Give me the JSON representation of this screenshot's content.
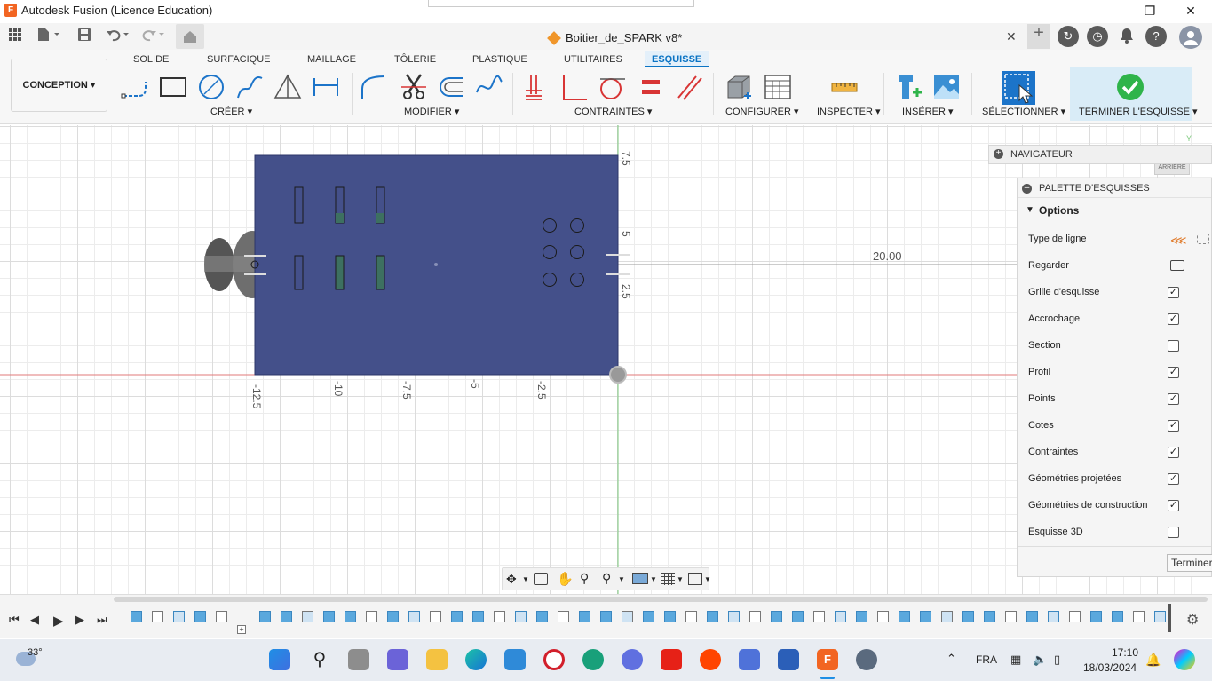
{
  "window": {
    "title": "Autodesk Fusion (Licence Education)"
  },
  "document": {
    "name": "Boitier_de_SPARK v8*"
  },
  "workspace": {
    "label": "CONCEPTION"
  },
  "ribbon": {
    "tabs": [
      "SOLIDE",
      "SURFACIQUE",
      "MAILLAGE",
      "TÔLERIE",
      "PLASTIQUE",
      "UTILITAIRES",
      "ESQUISSE"
    ],
    "active_tab": "ESQUISSE",
    "groups": {
      "create": "CRÉER",
      "modify": "MODIFIER",
      "constraints": "CONTRAINTES",
      "configure": "CONFIGURER",
      "inspect": "INSPECTER",
      "insert": "INSÉRER",
      "select": "SÉLECTIONNER",
      "finish": "TERMINER L'ESQUISSE"
    }
  },
  "canvas": {
    "x_ticks": [
      "-12.5",
      "-10",
      "-7.5",
      "-5",
      "-2.5"
    ],
    "y_ticks": [
      "7.5",
      "5",
      "2.5"
    ],
    "dimension": "20.00",
    "view_cube_label": "ARRIÈRE"
  },
  "navigator": {
    "label": "NAVIGATEUR"
  },
  "palette": {
    "title": "PALETTE D'ESQUISSES",
    "options_label": "Options",
    "rows": [
      {
        "label": "Type de ligne",
        "kind": "icon"
      },
      {
        "label": "Regarder",
        "kind": "icon"
      },
      {
        "label": "Grille d'esquisse",
        "checked": true
      },
      {
        "label": "Accrochage",
        "checked": true
      },
      {
        "label": "Section",
        "checked": false
      },
      {
        "label": "Profil",
        "checked": true
      },
      {
        "label": "Points",
        "checked": true
      },
      {
        "label": "Cotes",
        "checked": true
      },
      {
        "label": "Contraintes",
        "checked": true
      },
      {
        "label": "Géométries projetées",
        "checked": true
      },
      {
        "label": "Géométries de construction",
        "checked": true
      },
      {
        "label": "Esquisse 3D",
        "checked": false
      }
    ],
    "finish_button": "Terminer"
  },
  "taskbar": {
    "weather": "33°",
    "language": "FRA",
    "time": "17:10",
    "date": "18/03/2024"
  },
  "colors": {
    "accent": "#0b74c4",
    "sketch_fill": "#44508a",
    "finish_green": "#2fb44a"
  }
}
